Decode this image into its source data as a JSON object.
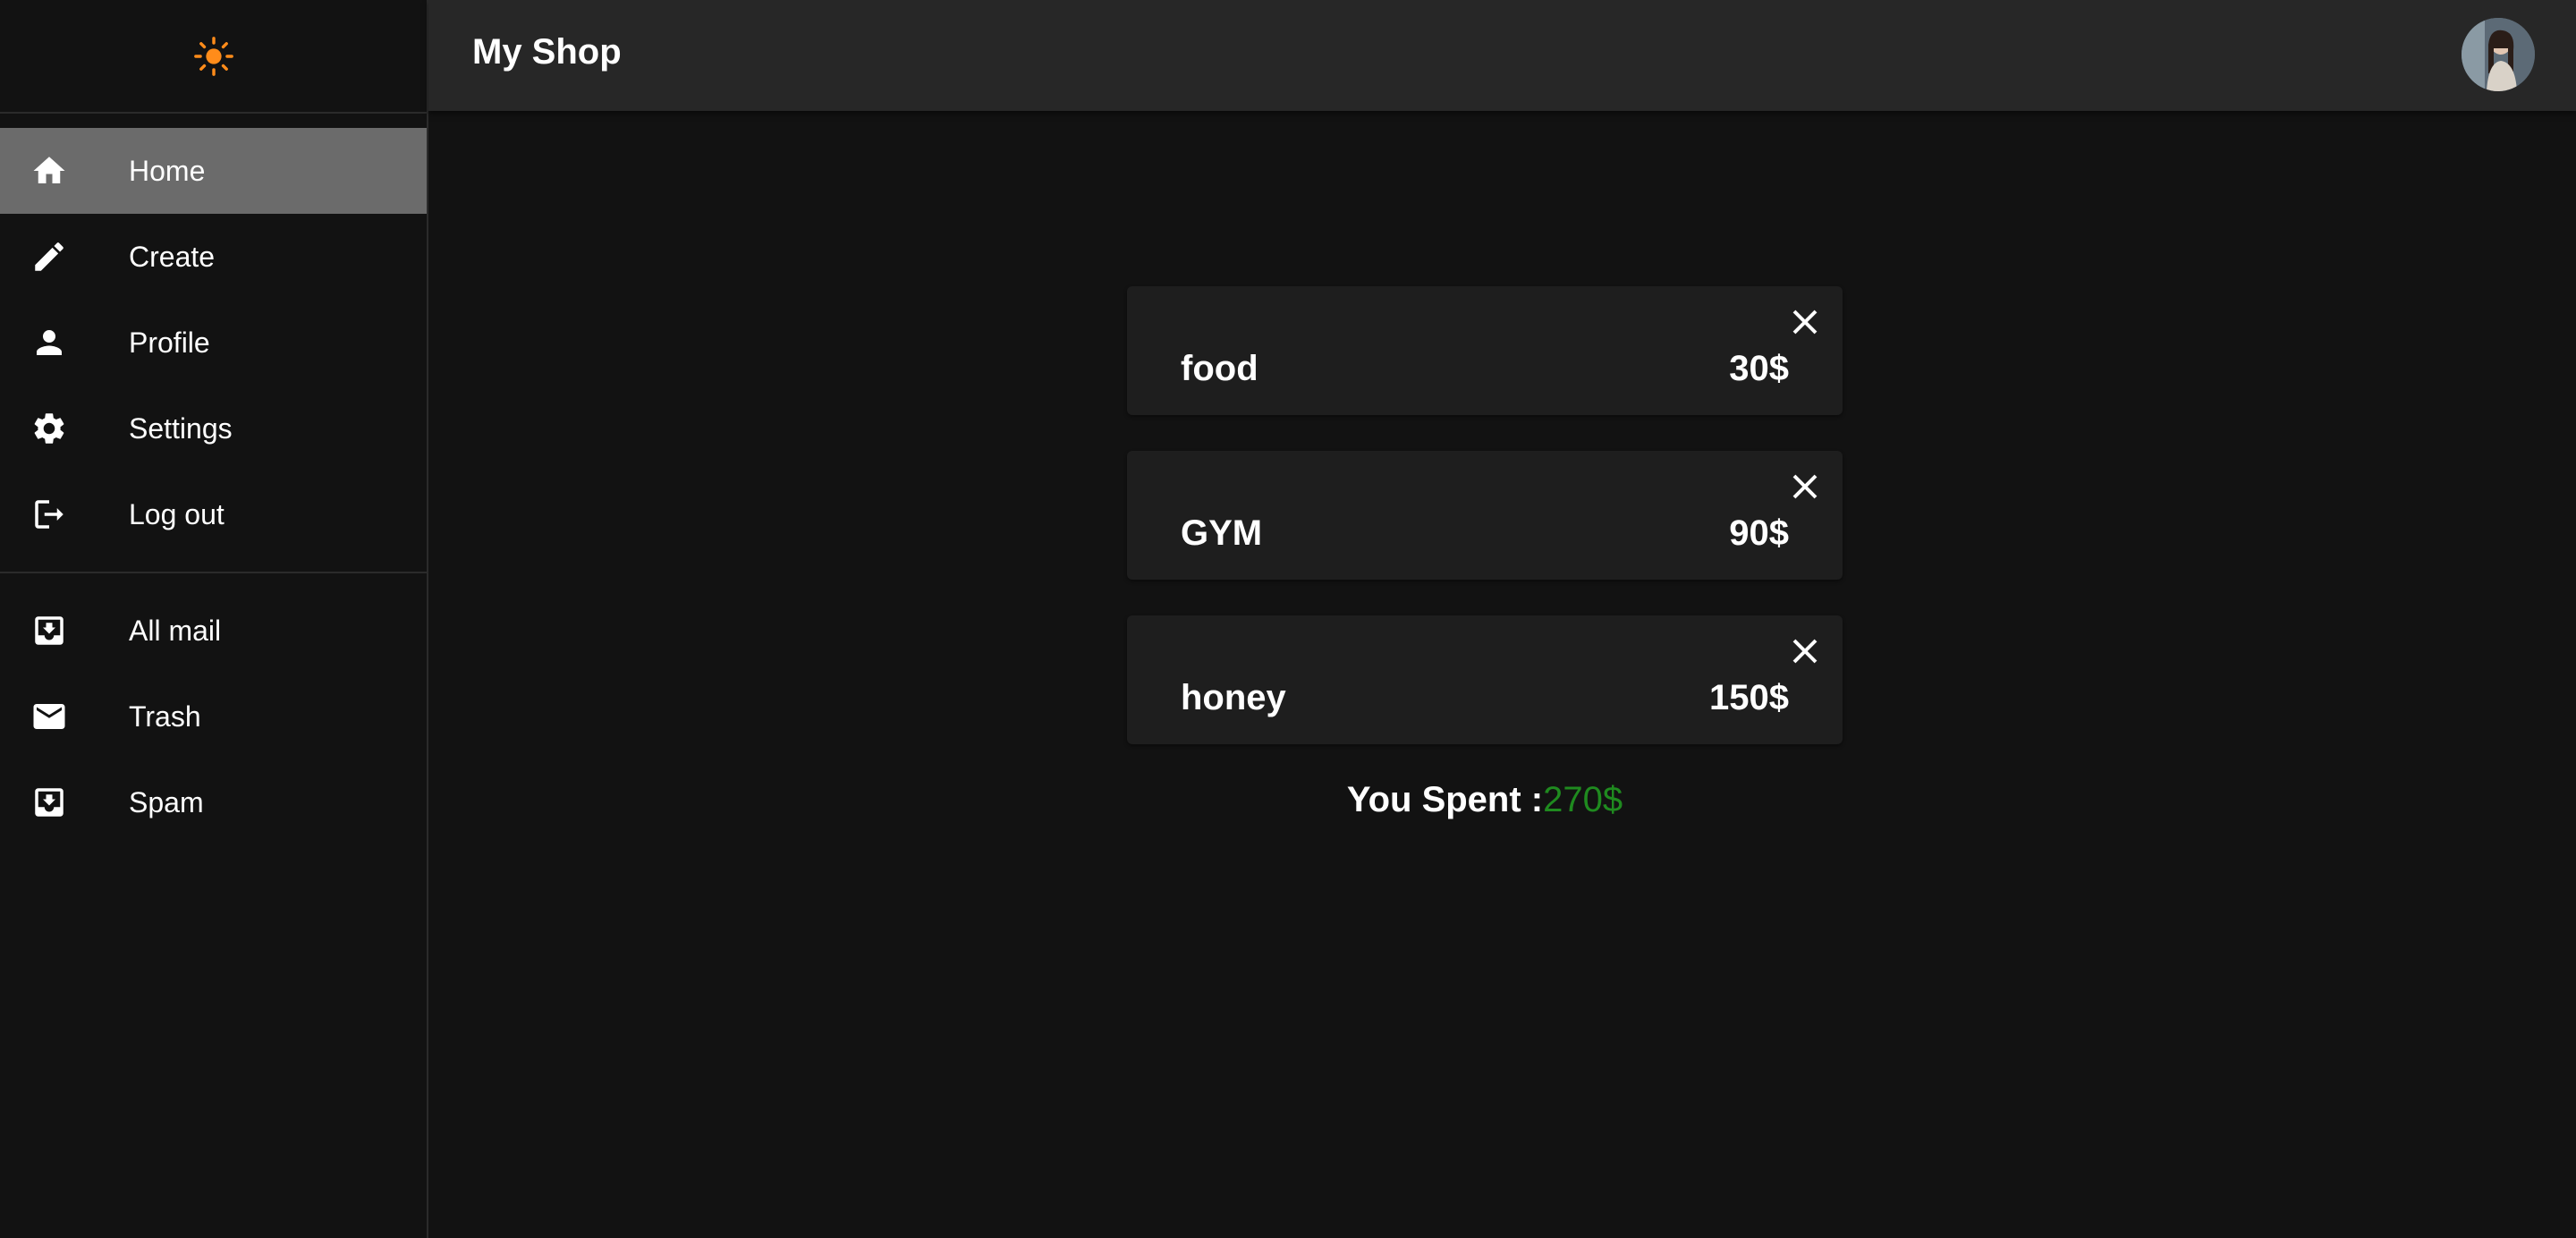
{
  "sidebar": {
    "theme_icon": "sun-icon",
    "theme_icon_color": "#ff8c1a",
    "primary_items": [
      {
        "label": "Home",
        "icon": "home-icon",
        "active": true
      },
      {
        "label": "Create",
        "icon": "pencil-icon",
        "active": false
      },
      {
        "label": "Profile",
        "icon": "person-icon",
        "active": false
      },
      {
        "label": "Settings",
        "icon": "gear-icon",
        "active": false
      },
      {
        "label": "Log out",
        "icon": "logout-icon",
        "active": false
      }
    ],
    "secondary_items": [
      {
        "label": "All mail",
        "icon": "inbox-icon"
      },
      {
        "label": "Trash",
        "icon": "mail-icon"
      },
      {
        "label": "Spam",
        "icon": "inbox-icon"
      }
    ]
  },
  "header": {
    "title": "My Shop",
    "avatar_icon": "avatar"
  },
  "expenses": [
    {
      "name": "food",
      "price": "30$"
    },
    {
      "name": "GYM",
      "price": "90$"
    },
    {
      "name": "honey",
      "price": "150$"
    }
  ],
  "summary": {
    "label": "You Spent :",
    "value": "270$",
    "value_color": "#1f8a1f"
  },
  "colors": {
    "background": "#121212",
    "appbar": "#272727",
    "card": "#1e1e1e",
    "active_item": "#6b6b6b"
  }
}
